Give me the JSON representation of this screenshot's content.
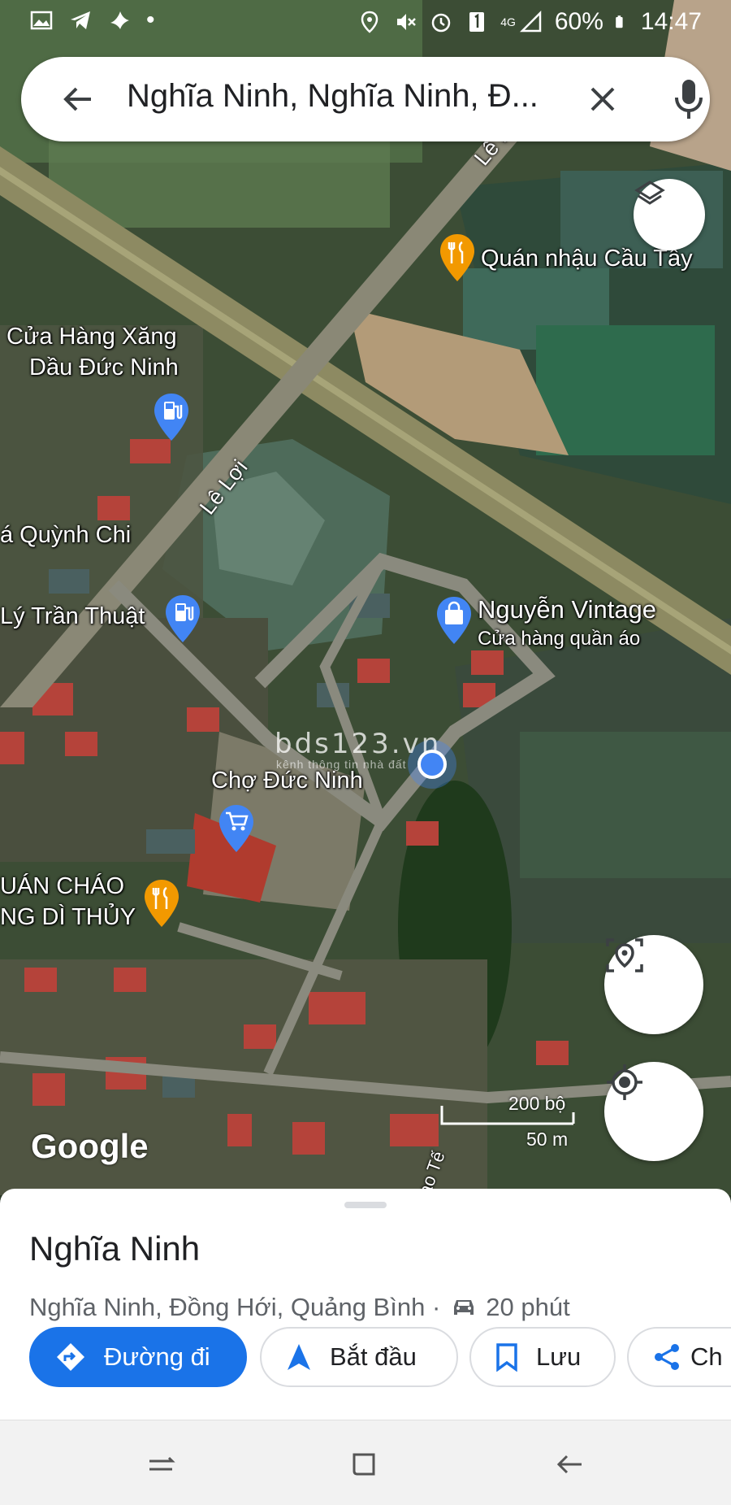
{
  "status_bar": {
    "battery": "60%",
    "time": "14:47",
    "network": "4G"
  },
  "search": {
    "query": "Nghĩa Ninh, Nghĩa Ninh, Đ..."
  },
  "map": {
    "road_labels": [
      "Lê Lợi",
      "Lê Lợi",
      "ạo Tế"
    ],
    "places": [
      {
        "name": "Quán nhậu Cầu Tây",
        "icon": "restaurant-icon"
      },
      {
        "line1": "Cửa Hàng Xăng",
        "line2": "Dầu Đức Ninh",
        "icon": "gas-station-icon"
      },
      {
        "name": "á Quỳnh Chi"
      },
      {
        "name": "Lý Trần Thuật",
        "icon": "gas-station-icon"
      },
      {
        "name": "Nguyễn Vintage",
        "sub": "Cửa hàng quần áo",
        "icon": "shopping-bag-icon"
      },
      {
        "name": "Chợ Đức Ninh",
        "icon": "shopping-cart-icon"
      },
      {
        "line1": "UÁN CHÁO",
        "line2": "NG DÌ THỦY",
        "icon": "restaurant-icon"
      }
    ],
    "watermark": {
      "main": "bds123.vn",
      "sub": "kênh thông tin nhà đất"
    },
    "logo": "Google",
    "scale": {
      "imperial": "200 bộ",
      "metric": "50 m"
    }
  },
  "sheet": {
    "title": "Nghĩa Ninh",
    "subtitle": "Nghĩa Ninh, Đồng Hới, Quảng Bình ·",
    "travel_time": "20 phút",
    "actions": [
      "Đường đi",
      "Bắt đầu",
      "Lưu",
      "Ch"
    ]
  },
  "colors": {
    "accent": "#1a73e8",
    "pin_blue": "#4285f4",
    "pin_orange": "#f29900"
  }
}
